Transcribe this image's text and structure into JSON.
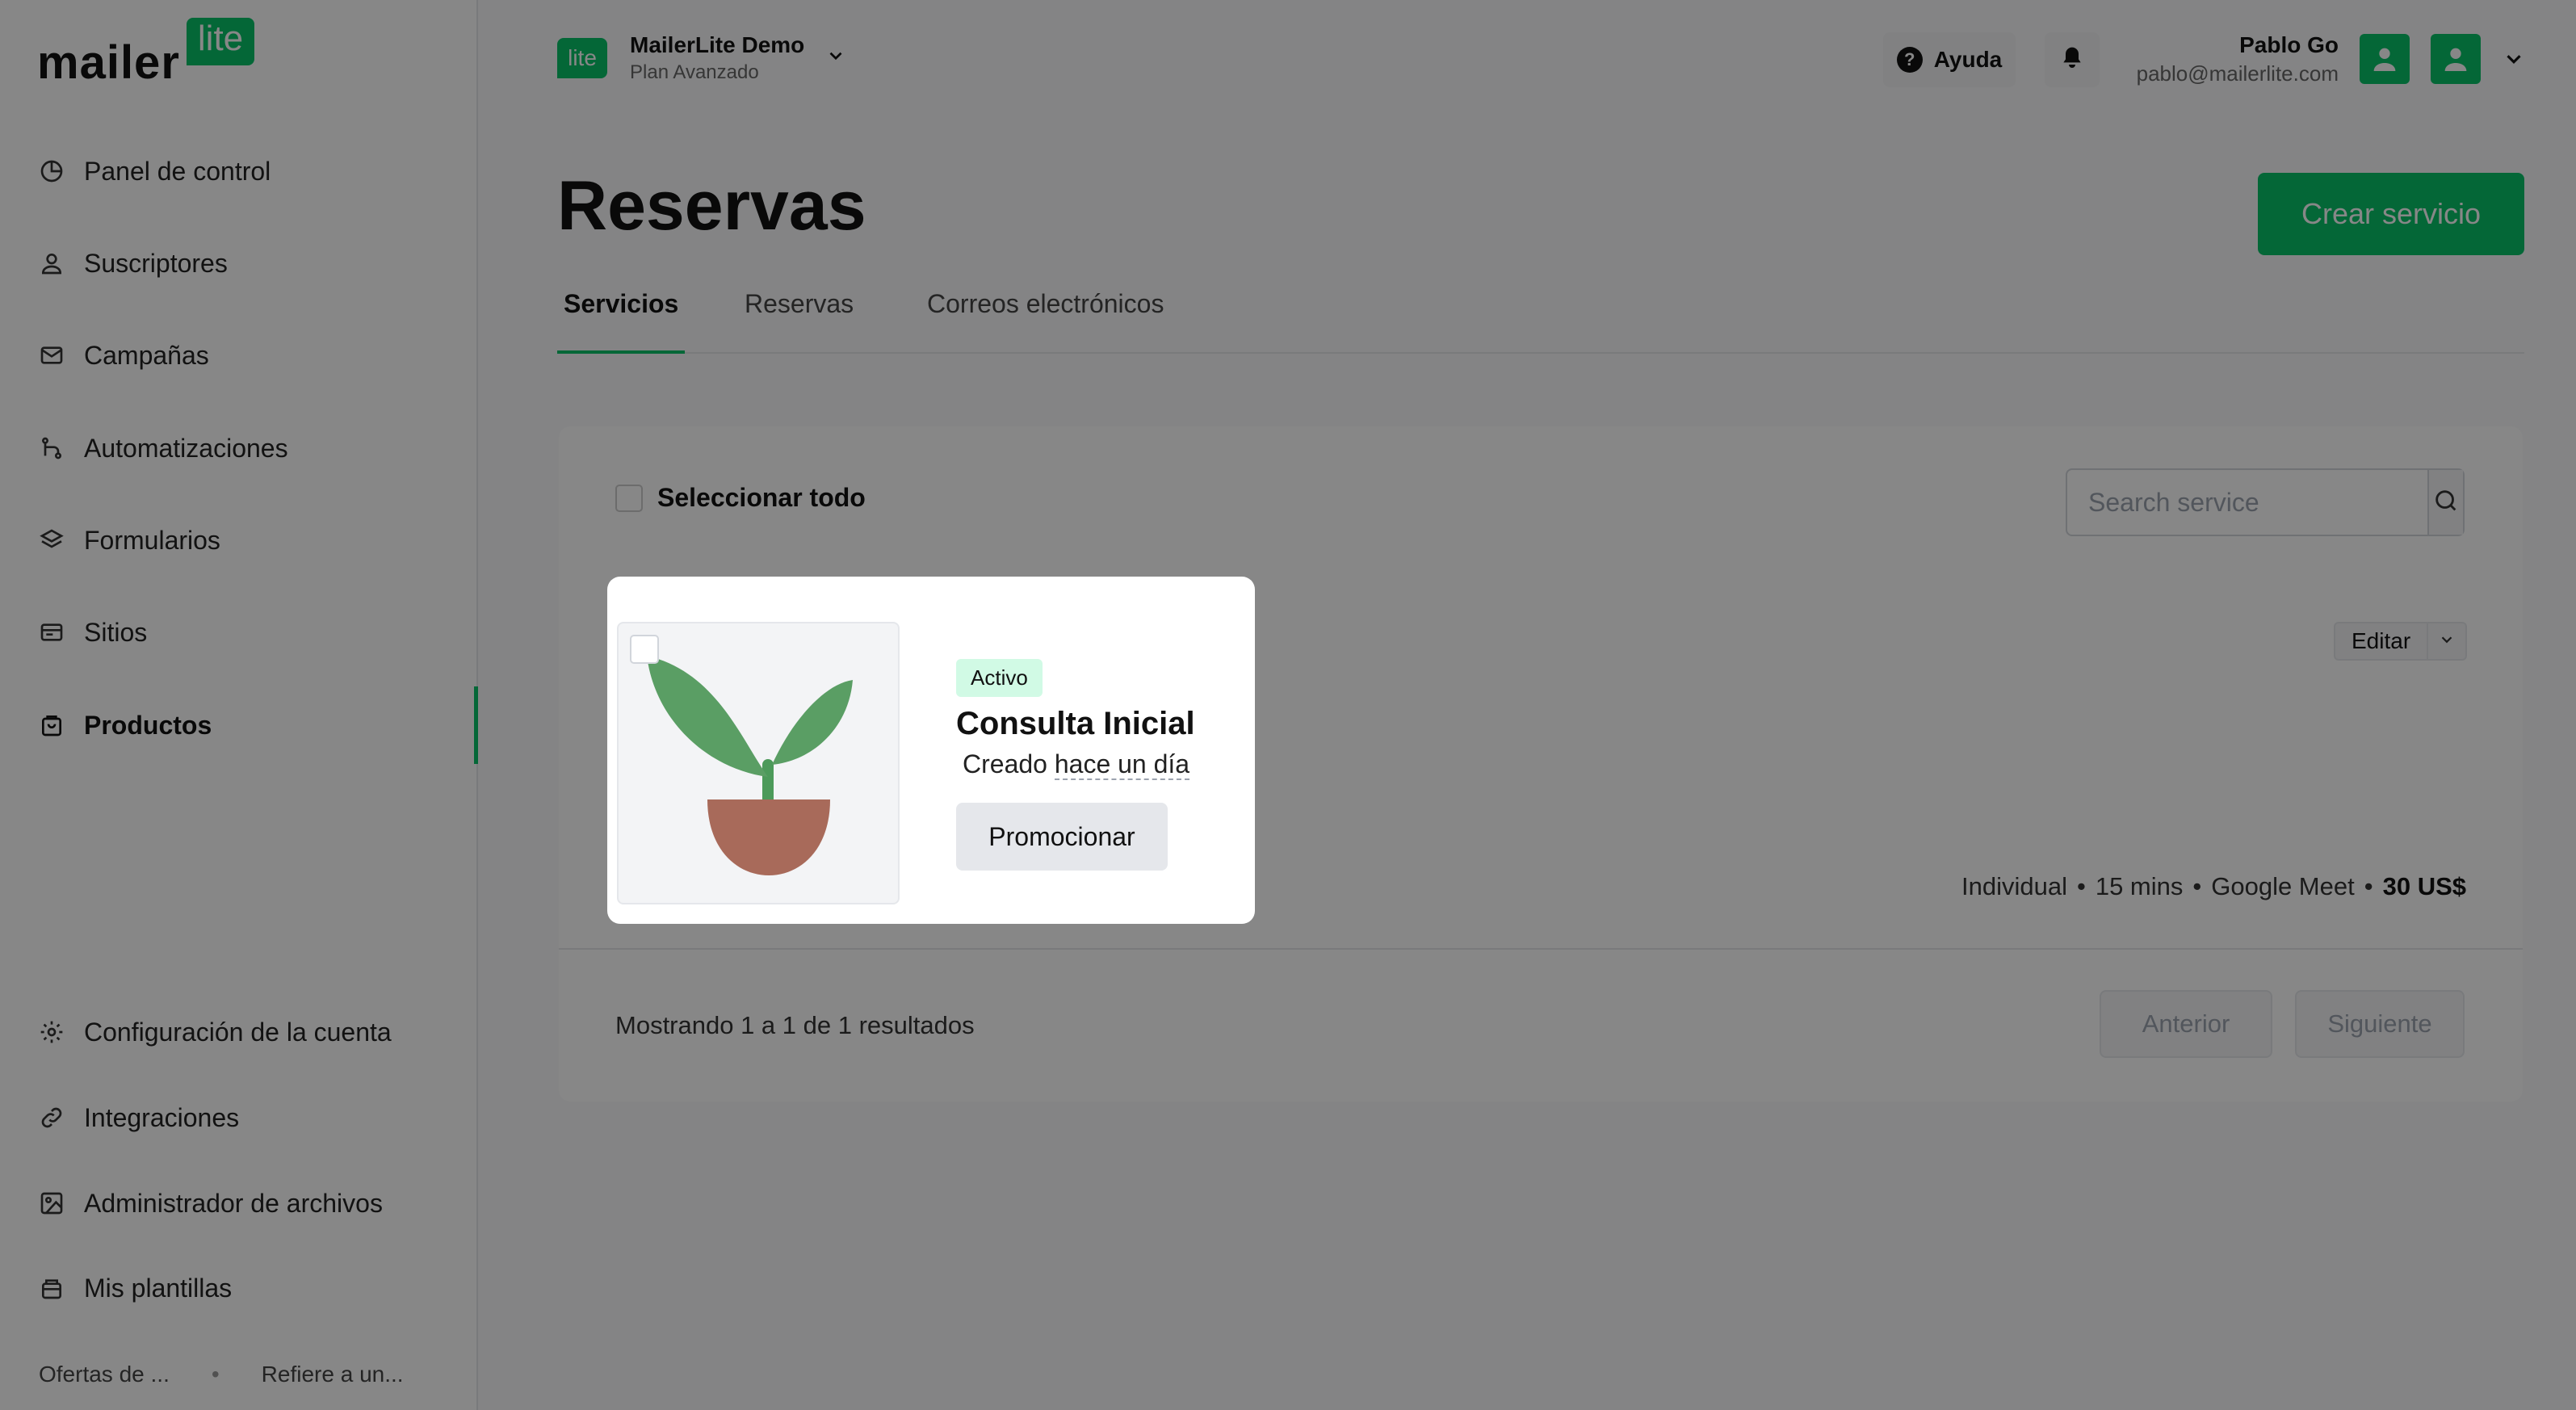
{
  "brand": {
    "logo_main": "mailer",
    "logo_badge": "lite",
    "accent": "#09c269"
  },
  "account": {
    "badge": "lite",
    "name": "MailerLite Demo",
    "plan": "Plan Avanzado"
  },
  "header": {
    "help_label": "Ayuda",
    "user_name": "Pablo Go",
    "user_email": "pablo@mailerlite.com"
  },
  "sidebar": {
    "items": [
      {
        "label": "Panel de control",
        "icon": "clock-icon"
      },
      {
        "label": "Suscriptores",
        "icon": "user-icon"
      },
      {
        "label": "Campañas",
        "icon": "mail-icon"
      },
      {
        "label": "Automatizaciones",
        "icon": "automation-icon"
      },
      {
        "label": "Formularios",
        "icon": "layers-icon"
      },
      {
        "label": "Sitios",
        "icon": "browser-icon"
      },
      {
        "label": "Productos",
        "icon": "bag-icon",
        "active": true
      }
    ],
    "bottom_items": [
      {
        "label": "Configuración de la cuenta",
        "icon": "gear-icon"
      },
      {
        "label": "Integraciones",
        "icon": "link-icon"
      },
      {
        "label": "Administrador de archivos",
        "icon": "image-icon"
      },
      {
        "label": "Mis plantillas",
        "icon": "template-icon"
      }
    ],
    "footer_left": "Ofertas de ...",
    "footer_right": "Refiere a un..."
  },
  "page": {
    "title": "Reservas",
    "create_label": "Crear servicio"
  },
  "tabs": [
    {
      "label": "Servicios",
      "active": true
    },
    {
      "label": "Reservas"
    },
    {
      "label": "Correos electrónicos"
    }
  ],
  "list": {
    "select_all": "Seleccionar todo",
    "search_placeholder": "Search service",
    "edit_label": "Editar",
    "results": "Mostrando 1 a 1 de 1 resultados",
    "prev_label": "Anterior",
    "next_label": "Siguiente"
  },
  "service": {
    "status": "Activo",
    "title": "Consulta Inicial",
    "created_prefix": "Creado",
    "created_rel": "hace un día",
    "promote_label": "Promocionar",
    "meta": {
      "type": "Individual",
      "duration": "15 mins",
      "location": "Google Meet",
      "price": "30 US$"
    }
  }
}
